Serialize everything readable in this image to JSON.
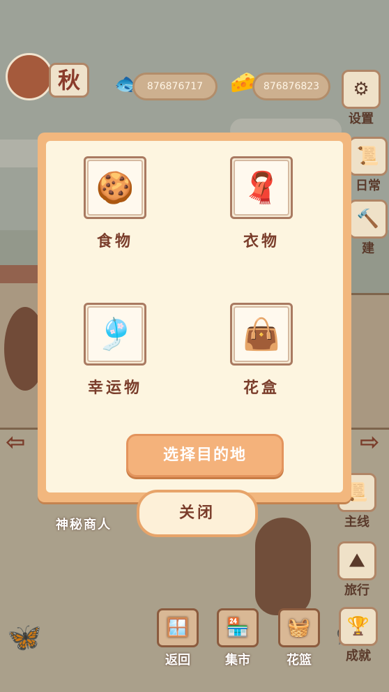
{
  "hud": {
    "season": "秋",
    "fish_amount": "876876717",
    "cheese_amount": "876876823",
    "fish_icon": "fish-bone-icon",
    "cheese_icon": "cheese-icon"
  },
  "side_menu": {
    "settings": "设置",
    "daily": "日常",
    "build": "建",
    "main_quest": "主线",
    "travel": "旅行",
    "achievement": "成就"
  },
  "popup": {
    "items": [
      {
        "label": "食物",
        "icon": "cookie-plate-icon"
      },
      {
        "label": "衣物",
        "icon": "scarf-icon"
      },
      {
        "label": "幸运物",
        "icon": "lucky-charm-icon"
      },
      {
        "label": "花盒",
        "icon": "flower-box-icon"
      }
    ],
    "choose_destination": "选择目的地",
    "close": "关闭"
  },
  "scene": {
    "merchant_label": "神秘商人"
  },
  "bottom_bar": {
    "back": "返回",
    "market": "集市",
    "basket": "花篮"
  },
  "colors": {
    "panel_border": "#f2b77e",
    "panel_bg": "#fdf5e0",
    "label_brown": "#7a3d2b",
    "button_orange": "#f4b27b"
  }
}
